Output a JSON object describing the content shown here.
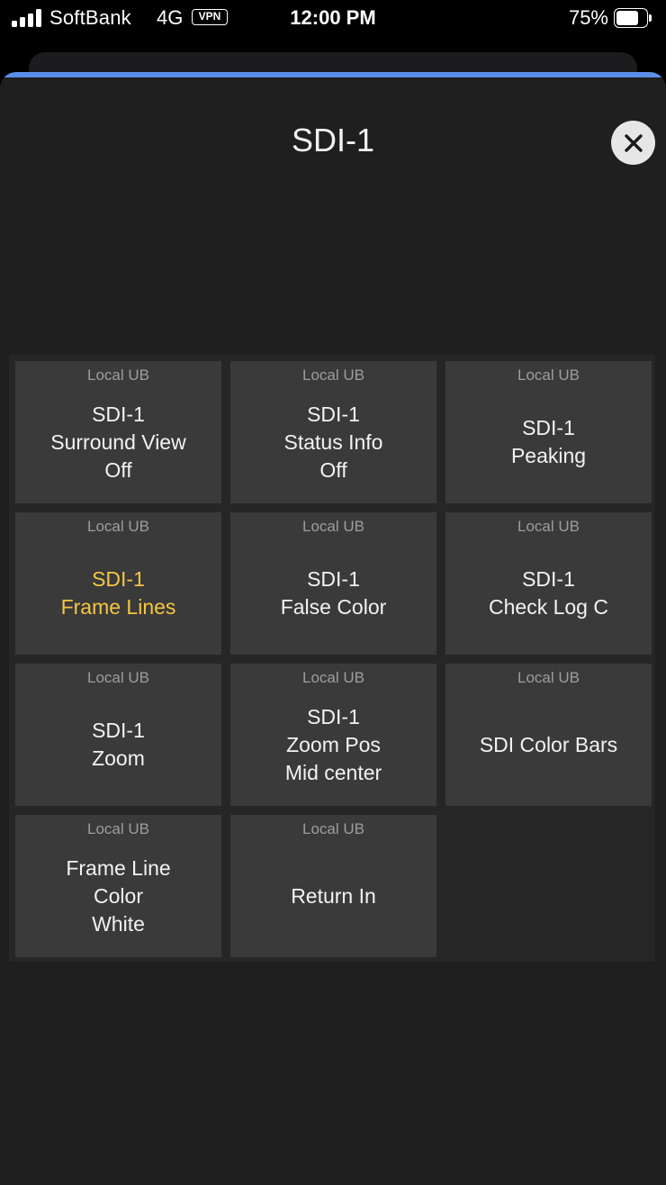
{
  "status_bar": {
    "carrier": "SoftBank",
    "network": "4G",
    "vpn": "VPN",
    "time": "12:00 PM",
    "battery_percent": "75%",
    "battery_level": 0.75
  },
  "sheet": {
    "title": "SDI-1",
    "close_icon": "close-icon",
    "accent_color": "#5b8ee8"
  },
  "tiles": [
    {
      "header": "Local UB",
      "lines": [
        "SDI-1",
        "Surround View",
        "Off"
      ],
      "active": false
    },
    {
      "header": "Local UB",
      "lines": [
        "SDI-1",
        "Status Info",
        "Off"
      ],
      "active": false
    },
    {
      "header": "Local UB",
      "lines": [
        "SDI-1",
        "Peaking"
      ],
      "active": false
    },
    {
      "header": "Local UB",
      "lines": [
        "SDI-1",
        "Frame Lines"
      ],
      "active": true
    },
    {
      "header": "Local UB",
      "lines": [
        "SDI-1",
        "False Color"
      ],
      "active": false
    },
    {
      "header": "Local UB",
      "lines": [
        "SDI-1",
        "Check Log C"
      ],
      "active": false
    },
    {
      "header": "Local UB",
      "lines": [
        "SDI-1",
        "Zoom"
      ],
      "active": false
    },
    {
      "header": "Local UB",
      "lines": [
        "SDI-1",
        "Zoom Pos",
        "Mid center"
      ],
      "active": false
    },
    {
      "header": "Local UB",
      "lines": [
        "SDI Color Bars"
      ],
      "active": false
    },
    {
      "header": "Local UB",
      "lines": [
        "Frame Line",
        "Color",
        "White"
      ],
      "active": false
    },
    {
      "header": "Local UB",
      "lines": [
        "Return In"
      ],
      "active": false
    }
  ],
  "colors": {
    "active_text": "#f5c542",
    "tile_background": "#3a3a3a",
    "header_text": "#9d9d9d"
  }
}
